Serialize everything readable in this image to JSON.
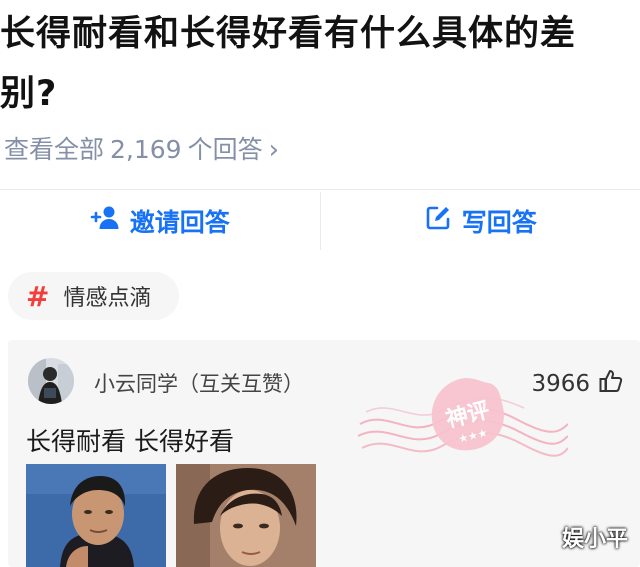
{
  "question": {
    "title": "长得耐看和长得好看有什么具体的差别?",
    "view_all_label": "查看全部",
    "answer_count": "2,169",
    "answer_unit": "个回答"
  },
  "actions": {
    "invite_label": "邀请回答",
    "write_label": "写回答"
  },
  "topic_tag": {
    "label": "情感点滴"
  },
  "answer_card": {
    "username": "小云同学（互关互赞）",
    "likes": "3966",
    "content": "长得耐看 长得好看",
    "stamp_text": "神评"
  },
  "watermark": "娱小平",
  "colors": {
    "accent": "#1772f6",
    "muted": "#8590a6",
    "tag_hash": "#f1403c",
    "stamp": "#f2a3b3"
  }
}
